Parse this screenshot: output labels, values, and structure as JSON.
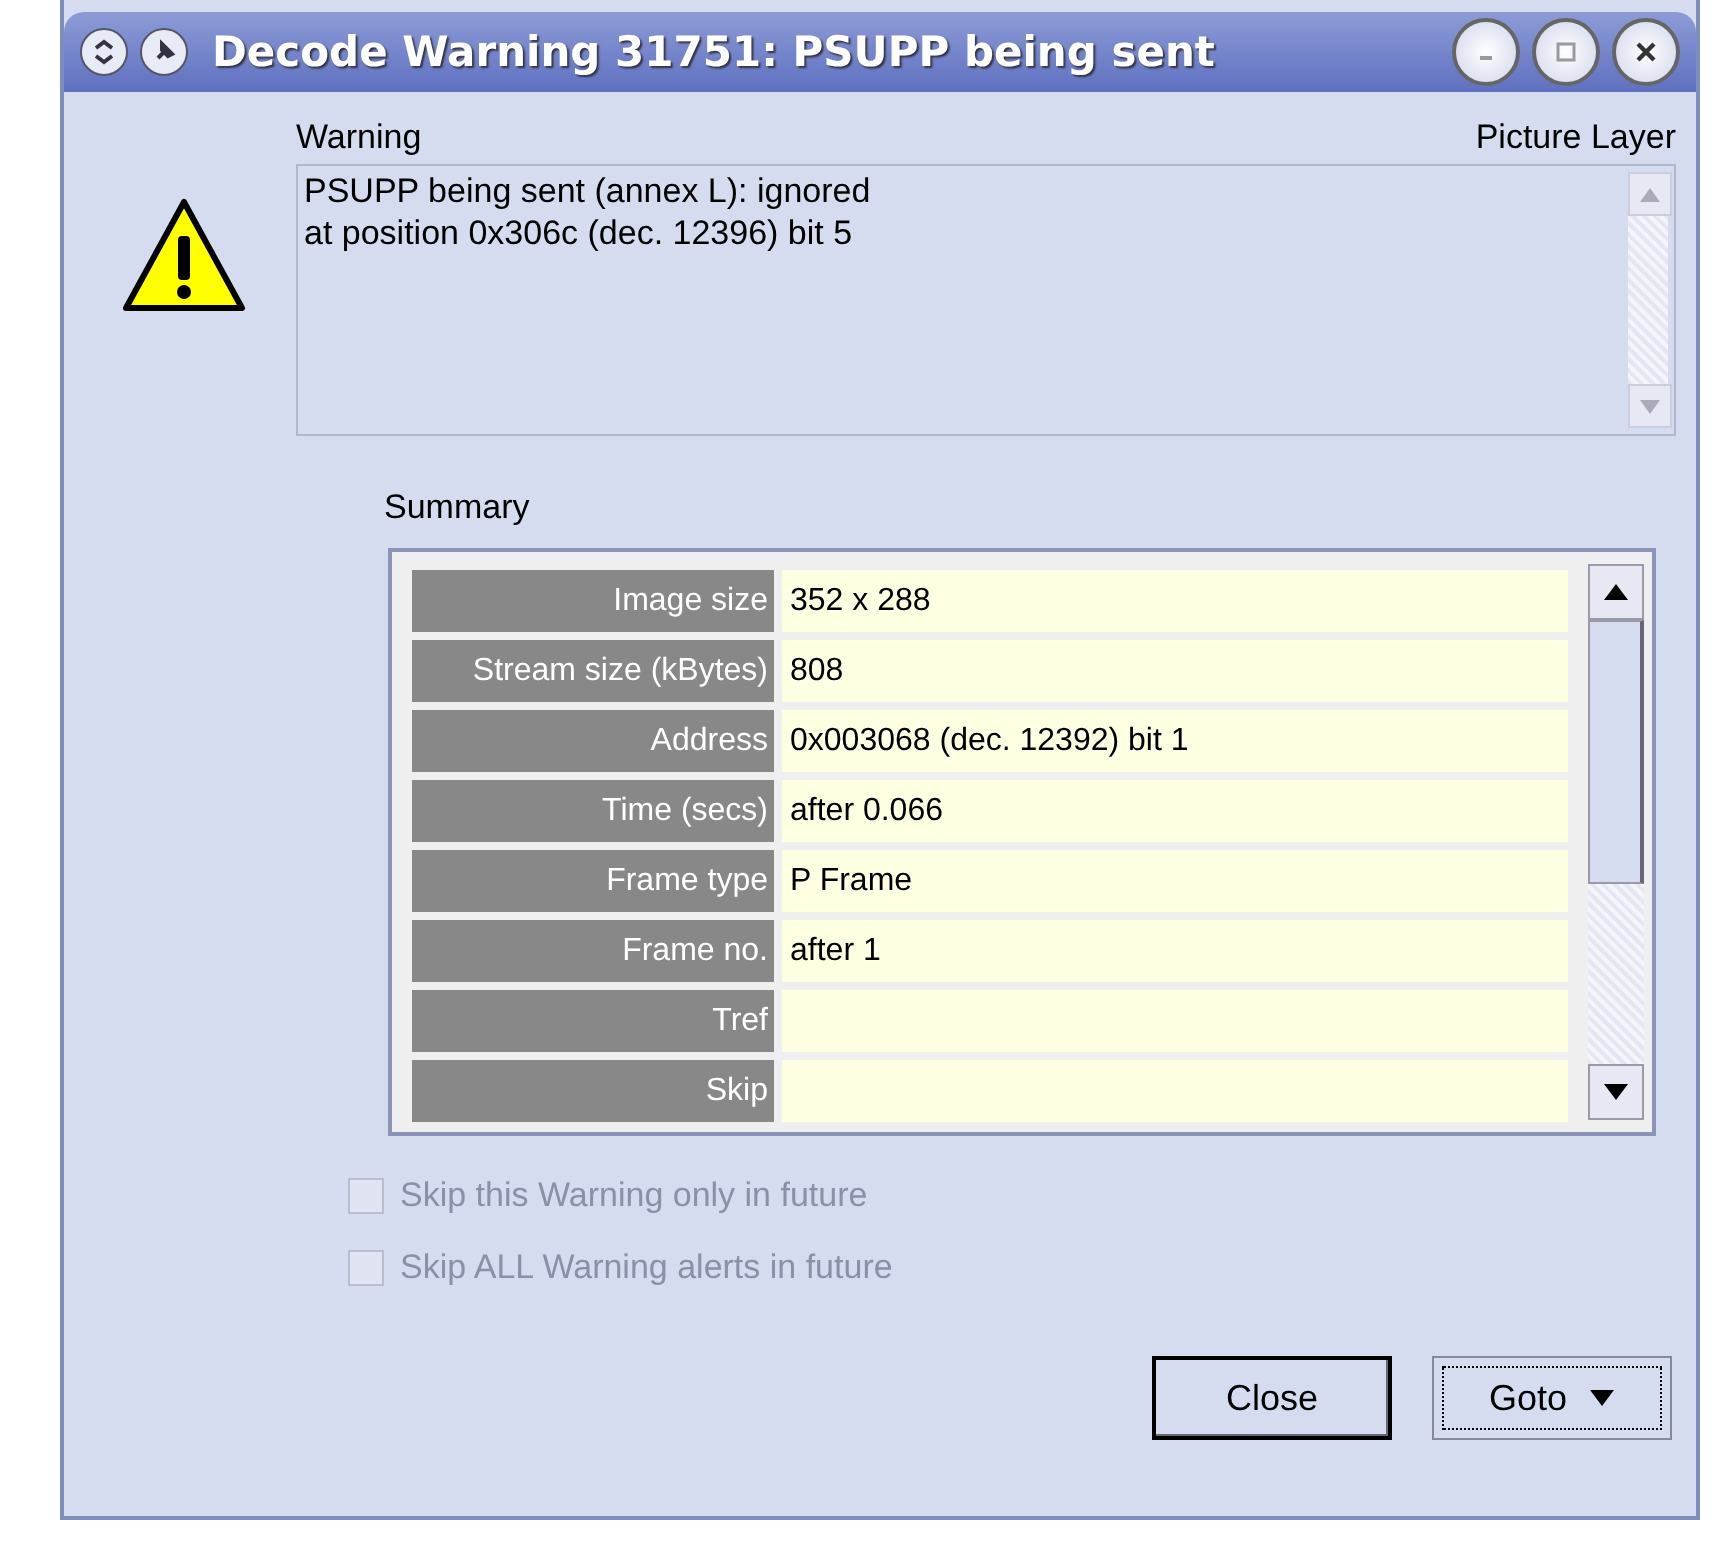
{
  "window": {
    "title": "Decode Warning 31751: PSUPP being sent"
  },
  "warning": {
    "label": "Warning",
    "layer": "Picture Layer",
    "message": [
      "PSUPP being sent (annex L): ignored",
      "at position 0x306c (dec. 12396) bit 5"
    ]
  },
  "summary": {
    "label": "Summary",
    "rows": [
      {
        "name": "Image size",
        "value": "352 x 288"
      },
      {
        "name": "Stream size (kBytes)",
        "value": "808"
      },
      {
        "name": "Address",
        "value": "0x003068 (dec. 12392) bit 1"
      },
      {
        "name": "Time (secs)",
        "value": "after 0.066"
      },
      {
        "name": "Frame type",
        "value": "P Frame"
      },
      {
        "name": "Frame no.",
        "value": "after 1"
      },
      {
        "name": "Tref",
        "value": ""
      },
      {
        "name": "Skip",
        "value": ""
      }
    ]
  },
  "options": [
    {
      "label": "Skip this Warning only in future",
      "checked": false,
      "disabled": true
    },
    {
      "label": "Skip ALL Warning alerts in future",
      "checked": false,
      "disabled": true
    }
  ],
  "buttons": [
    {
      "label": "Close",
      "focused": false,
      "dropdown": false
    },
    {
      "label": "Goto",
      "focused": true,
      "dropdown": true
    }
  ]
}
